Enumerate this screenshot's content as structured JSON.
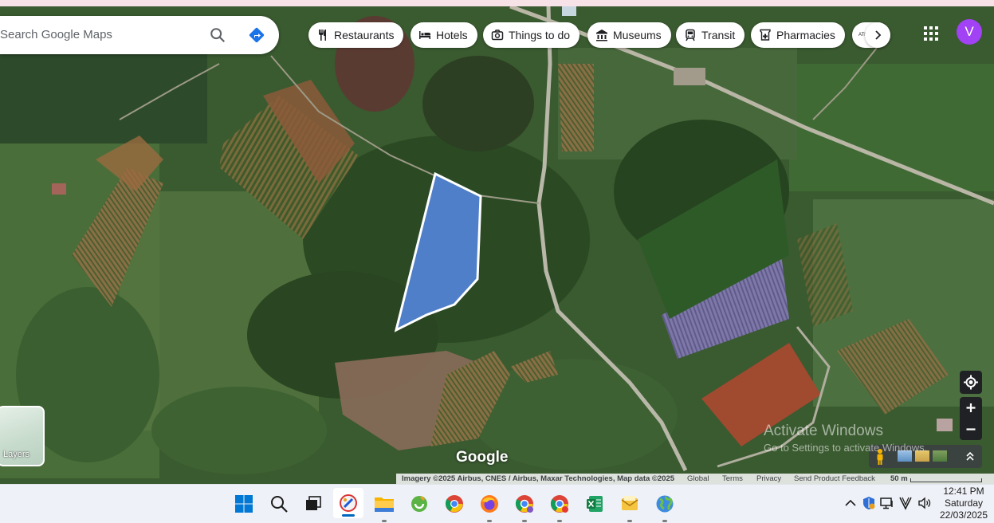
{
  "search": {
    "placeholder": "Search Google Maps"
  },
  "chips": [
    {
      "label": "Restaurants",
      "icon": "fork-knife-icon"
    },
    {
      "label": "Hotels",
      "icon": "bed-icon"
    },
    {
      "label": "Things to do",
      "icon": "camera-icon"
    },
    {
      "label": "Museums",
      "icon": "museum-icon"
    },
    {
      "label": "Transit",
      "icon": "train-icon"
    },
    {
      "label": "Pharmacies",
      "icon": "pharmacy-icon"
    },
    {
      "label": "ATMs",
      "icon": "atm-icon"
    }
  ],
  "account": {
    "initial": "V",
    "color": "#a142f4"
  },
  "layers": {
    "label": "Layers"
  },
  "brand": {
    "wordmark": "Google"
  },
  "watermark": {
    "line1": "Activate Windows",
    "line2": "Go to Settings to activate Windows."
  },
  "attribution": {
    "imagery": "Imagery ©2025 Airbus, CNES / Airbus, Maxar Technologies, Map data ©2025",
    "global": "Global",
    "terms": "Terms",
    "privacy": "Privacy",
    "feedback": "Send Product Feedback",
    "scale": "50 m"
  },
  "polygon": {
    "fill": "#4f7fc8",
    "stroke": "#ffffff"
  },
  "taskbar": {
    "apps": [
      "windows-start-icon",
      "search-icon",
      "task-view-icon",
      "paint-app-icon",
      "file-explorer-icon",
      "app-icon",
      "chrome-icon",
      "firefox-icon",
      "chrome-profile-icon",
      "chrome-profile-2-icon",
      "excel-icon",
      "mail-icon",
      "earth-app-icon"
    ],
    "clock": {
      "time": "12:41 PM",
      "day": "Saturday",
      "date": "22/03/2025"
    }
  }
}
